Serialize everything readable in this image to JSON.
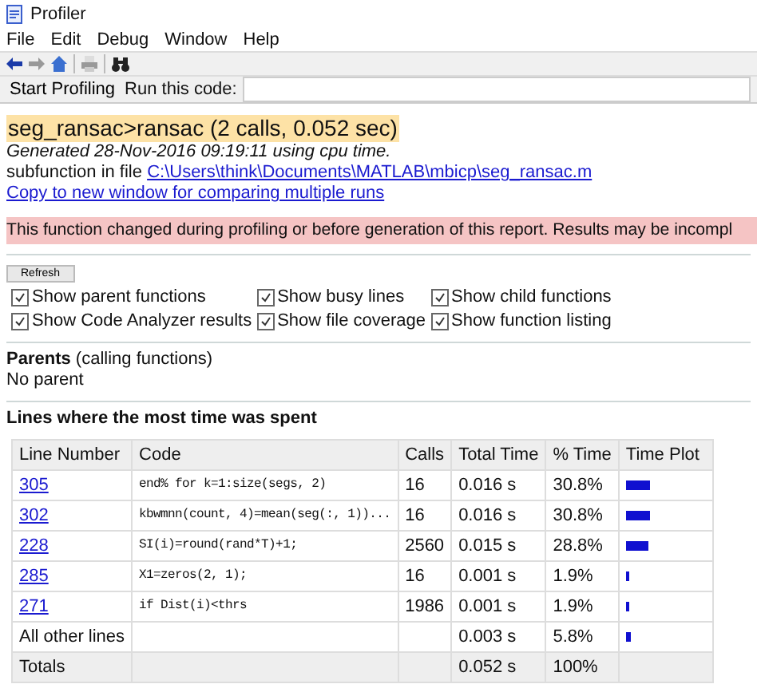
{
  "window": {
    "title": "Profiler"
  },
  "menu": [
    "File",
    "Edit",
    "Debug",
    "Window",
    "Help"
  ],
  "run_bar": {
    "start_button": "Start Profiling",
    "label": "Run this code:"
  },
  "report": {
    "heading": "seg_ransac>ransac (2 calls, 0.052 sec)",
    "generated": "Generated 28-Nov-2016 09:19:11 using cpu time.",
    "subfunction_prefix": "subfunction in file",
    "file_link": "C:\\Users\\think\\Documents\\MATLAB\\mbicp\\seg_ransac.m",
    "copy_link": "Copy to new window for comparing multiple runs",
    "warning": "This function changed during profiling or before generation of this report. Results may be incompl"
  },
  "refresh_button": "Refresh",
  "options": [
    {
      "label": "Show parent functions",
      "checked": true
    },
    {
      "label": "Show busy lines",
      "checked": true
    },
    {
      "label": "Show child functions",
      "checked": true
    },
    {
      "label": "Show Code Analyzer results",
      "checked": true
    },
    {
      "label": "Show file coverage",
      "checked": true
    },
    {
      "label": "Show function listing",
      "checked": true
    }
  ],
  "parents": {
    "title": "Parents",
    "subtitle": "(calling functions)",
    "text": "No parent"
  },
  "lines_title": "Lines where the most time was spent",
  "table": {
    "columns": [
      "Line Number",
      "Code",
      "Calls",
      "Total Time",
      "% Time",
      "Time Plot"
    ],
    "rows": [
      {
        "kind": "line",
        "line": "305",
        "code": "end%   for k=1:size(segs, 2)",
        "calls": "16",
        "total": "0.016 s",
        "percent": "30.8%",
        "level": 0.308
      },
      {
        "kind": "line",
        "line": "302",
        "code": "kbwmnn(count, 4)=mean(seg(:, 1))...",
        "calls": "16",
        "total": "0.016 s",
        "percent": "30.8%",
        "level": 0.308
      },
      {
        "kind": "line",
        "line": "228",
        "code": "SI(i)=round(rand*T)+1;",
        "calls": "2560",
        "total": "0.015 s",
        "percent": "28.8%",
        "level": 0.288
      },
      {
        "kind": "line",
        "line": "285",
        "code": "X1=zeros(2, 1);",
        "calls": "16",
        "total": "0.001 s",
        "percent": "1.9%",
        "level": 0.019
      },
      {
        "kind": "line",
        "line": "271",
        "code": "if Dist(i)<thrs",
        "calls": "1986",
        "total": "0.001 s",
        "percent": "1.9%",
        "level": 0.019
      },
      {
        "kind": "other",
        "line": "All other lines",
        "total": "0.003 s",
        "percent": "5.8%",
        "level": 0.058
      },
      {
        "kind": "total",
        "line": "Totals",
        "total": "0.052 s",
        "percent": "100%"
      }
    ]
  }
}
